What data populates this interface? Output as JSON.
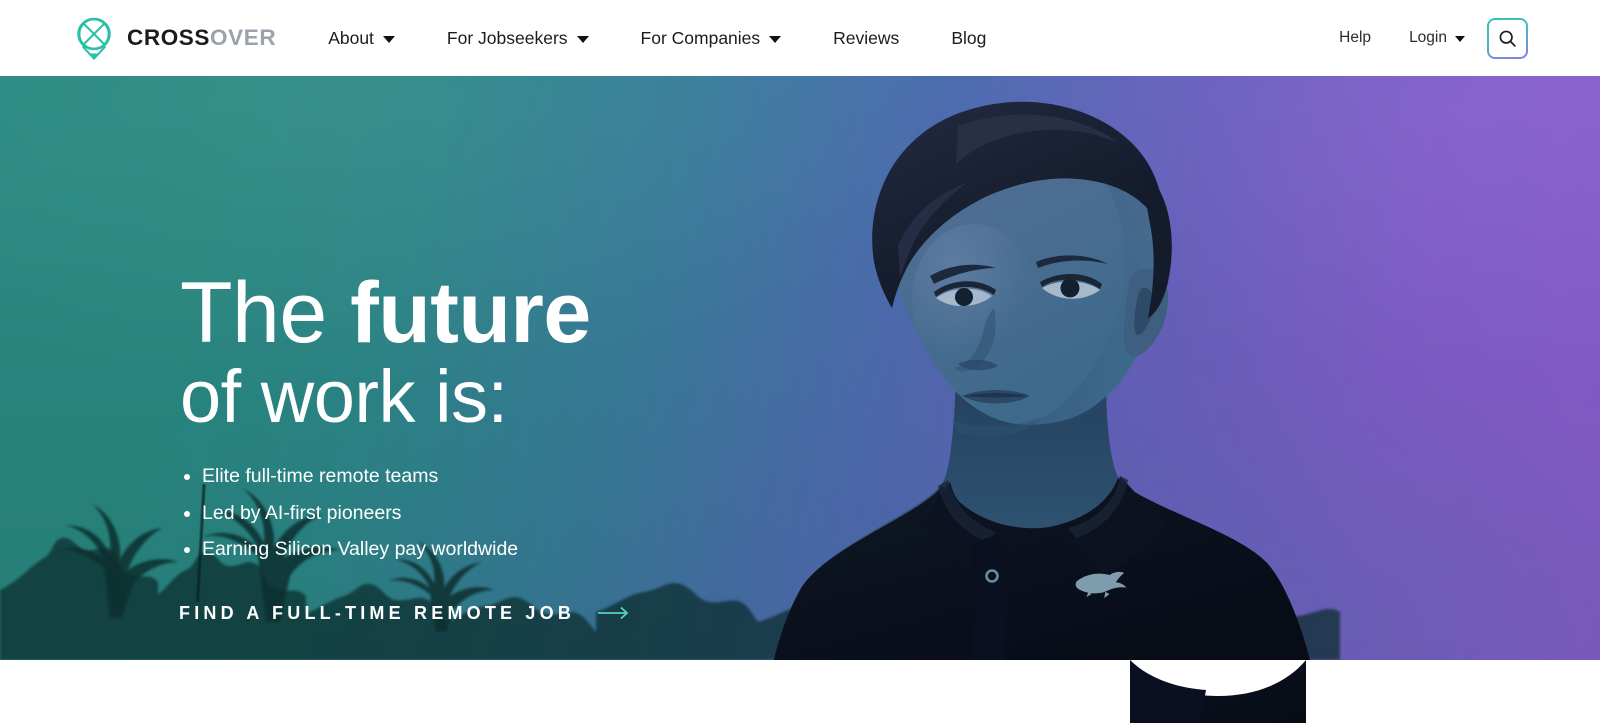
{
  "header": {
    "brand": {
      "name_part1": "CROSS",
      "name_part2": "OVER",
      "logo_icon": "crossover-circle-x-pin-logo"
    },
    "nav": [
      {
        "label": "About",
        "has_dropdown": true
      },
      {
        "label": "For Jobseekers",
        "has_dropdown": true
      },
      {
        "label": "For Companies",
        "has_dropdown": true
      },
      {
        "label": "Reviews",
        "has_dropdown": false
      },
      {
        "label": "Blog",
        "has_dropdown": false
      }
    ],
    "help_label": "Help",
    "login_label": "Login",
    "search_icon": "search-icon"
  },
  "hero": {
    "headline_line1_light": "The ",
    "headline_line1_bold": "future",
    "headline_line2": "of work is:",
    "bullets": [
      "Elite full-time remote teams",
      "Led by AI-first pioneers",
      "Earning Silicon Valley pay worldwide"
    ],
    "cta_label": "FIND A FULL-TIME REMOTE JOB",
    "cta_arrow_icon": "arrow-right-icon"
  },
  "colors": {
    "gradient_left": "#2a8c85",
    "gradient_mid": "#4f6fb3",
    "gradient_right": "#8f5fd2",
    "accent_teal": "#2fc3ae",
    "accent_purple": "#8e7ae0",
    "brand_dark": "#1b1b1b",
    "brand_gray": "#9aa3ad",
    "white": "#ffffff"
  }
}
